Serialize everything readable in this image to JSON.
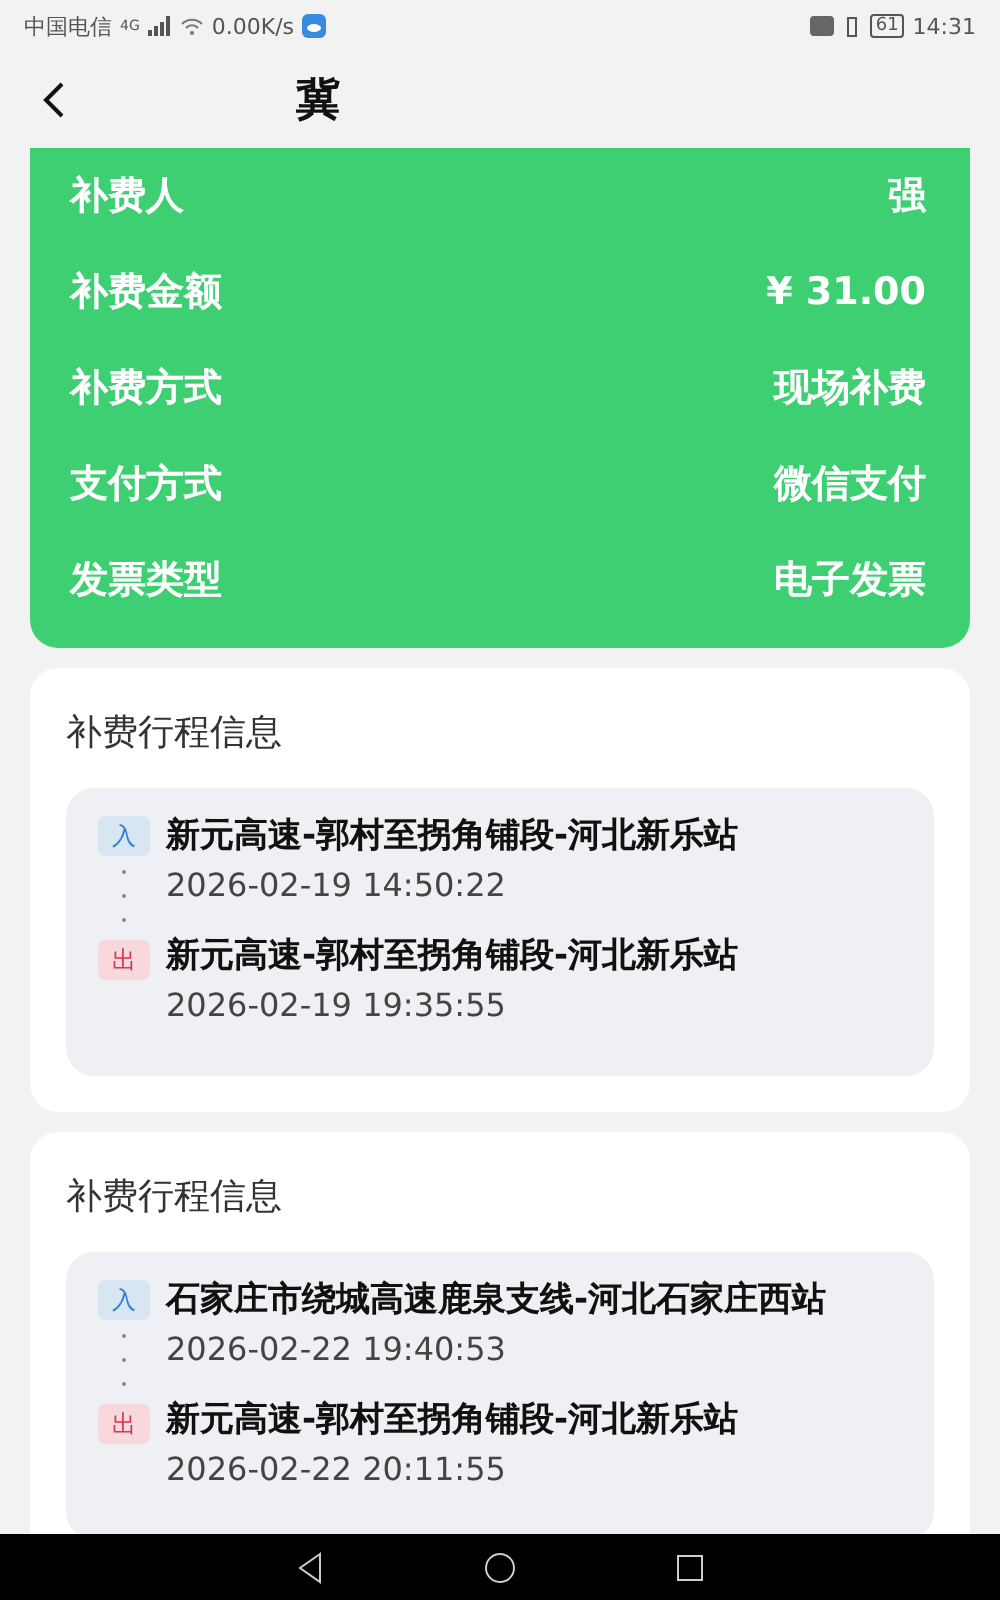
{
  "status_bar": {
    "carrier": "中国电信",
    "network": "4G",
    "speed": "0.00K/s",
    "battery": "61",
    "time": "14:31"
  },
  "header": {
    "title": "冀"
  },
  "summary": [
    {
      "label": "补费人",
      "value": "强"
    },
    {
      "label": "补费金额",
      "value": "¥ 31.00"
    },
    {
      "label": "补费方式",
      "value": "现场补费"
    },
    {
      "label": "支付方式",
      "value": "微信支付"
    },
    {
      "label": "发票类型",
      "value": "电子发票"
    }
  ],
  "trips": [
    {
      "title": "补费行程信息",
      "stops": [
        {
          "kind": "entry",
          "tag": "入",
          "station": "新元高速-郭村至拐角铺段-河北新乐站",
          "time": "2026-02-19 14:50:22"
        },
        {
          "kind": "exit",
          "tag": "出",
          "station": "新元高速-郭村至拐角铺段-河北新乐站",
          "time": "2026-02-19 19:35:55"
        }
      ]
    },
    {
      "title": "补费行程信息",
      "stops": [
        {
          "kind": "entry",
          "tag": "入",
          "station": "石家庄市绕城高速鹿泉支线-河北石家庄西站",
          "time": "2026-02-22 19:40:53"
        },
        {
          "kind": "exit",
          "tag": "出",
          "station": "新元高速-郭村至拐角铺段-河北新乐站",
          "time": "2026-02-22 20:11:55"
        }
      ]
    }
  ]
}
